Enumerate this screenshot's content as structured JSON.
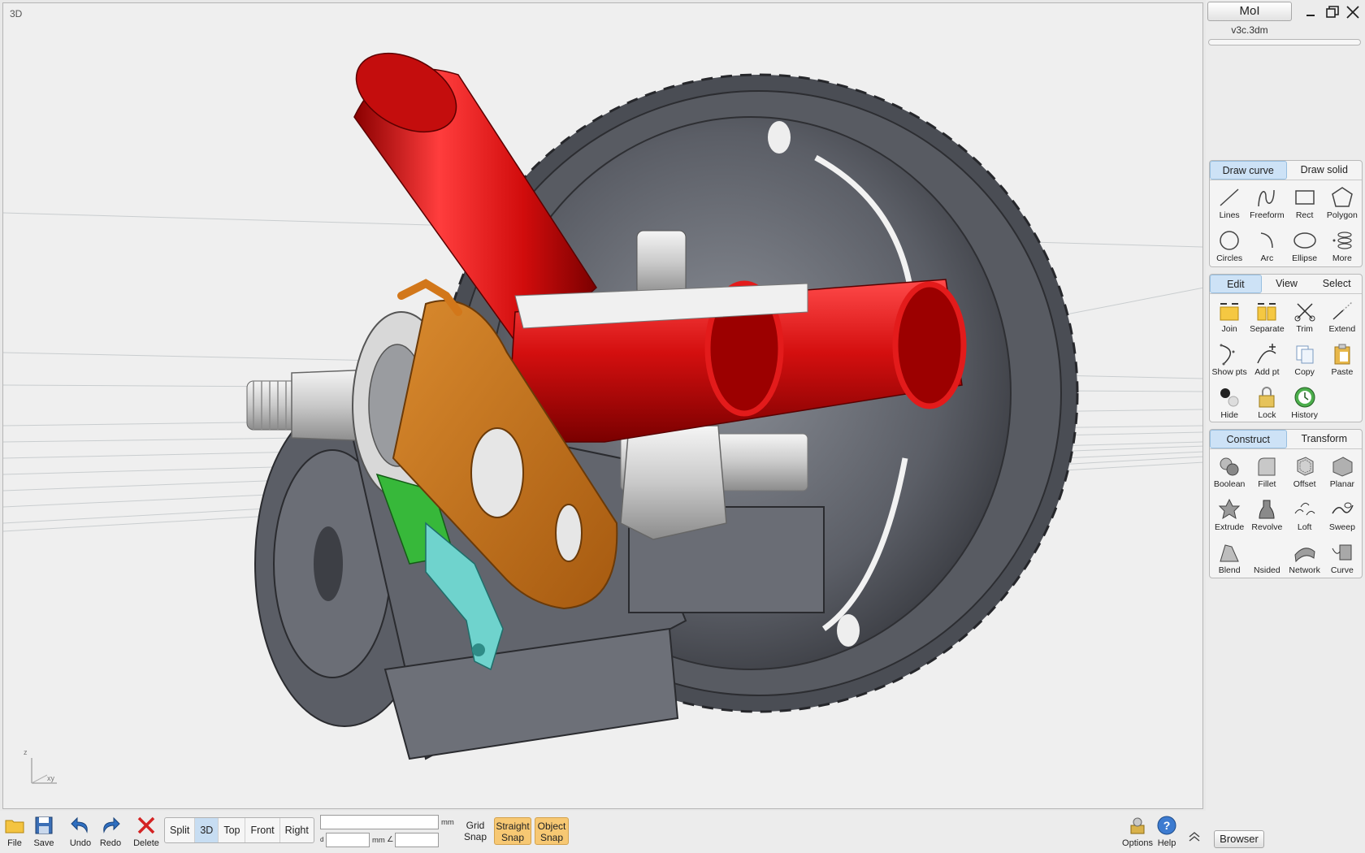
{
  "app": {
    "name": "MoI",
    "file_name": "v3c.3dm"
  },
  "viewport": {
    "label": "3D",
    "axis_z": "z",
    "axis_xy": "xy"
  },
  "draw_group": {
    "tabs": [
      "Draw curve",
      "Draw solid"
    ],
    "active_tab": "Draw curve",
    "tools": [
      "Lines",
      "Freeform",
      "Rect",
      "Polygon",
      "Circles",
      "Arc",
      "Ellipse",
      "More"
    ]
  },
  "edit_group": {
    "tabs": [
      "Edit",
      "View",
      "Select"
    ],
    "active_tab": "Edit",
    "tools": [
      "Join",
      "Separate",
      "Trim",
      "Extend",
      "Show pts",
      "Add pt",
      "Copy",
      "Paste",
      "Hide",
      "Lock",
      "History"
    ]
  },
  "construct_group": {
    "tabs": [
      "Construct",
      "Transform"
    ],
    "active_tab": "Construct",
    "tools": [
      "Boolean",
      "Fillet",
      "Offset",
      "Planar",
      "Extrude",
      "Revolve",
      "Loft",
      "Sweep",
      "Blend",
      "Nsided",
      "Network",
      "Curve"
    ]
  },
  "bottom": {
    "file": "File",
    "save": "Save",
    "undo": "Undo",
    "redo": "Redo",
    "delete": "Delete",
    "views": [
      "Split",
      "3D",
      "Top",
      "Front",
      "Right"
    ],
    "active_view": "3D",
    "unit_mm": "mm",
    "distance_label": "d",
    "unit_mm_2": "mm",
    "angle_label": "∠",
    "grid_snap_1": "Grid",
    "grid_snap_2": "Snap",
    "straight_snap_1": "Straight",
    "straight_snap_2": "Snap",
    "object_snap_1": "Object",
    "object_snap_2": "Snap",
    "options": "Options",
    "help": "Help",
    "browser": "Browser"
  },
  "colors": {
    "accent_tab": "#cde2f6",
    "snap_on": "#f7c873",
    "frame_red": "#d01010",
    "chainring": "#55585f",
    "arm": "#c8751c"
  }
}
